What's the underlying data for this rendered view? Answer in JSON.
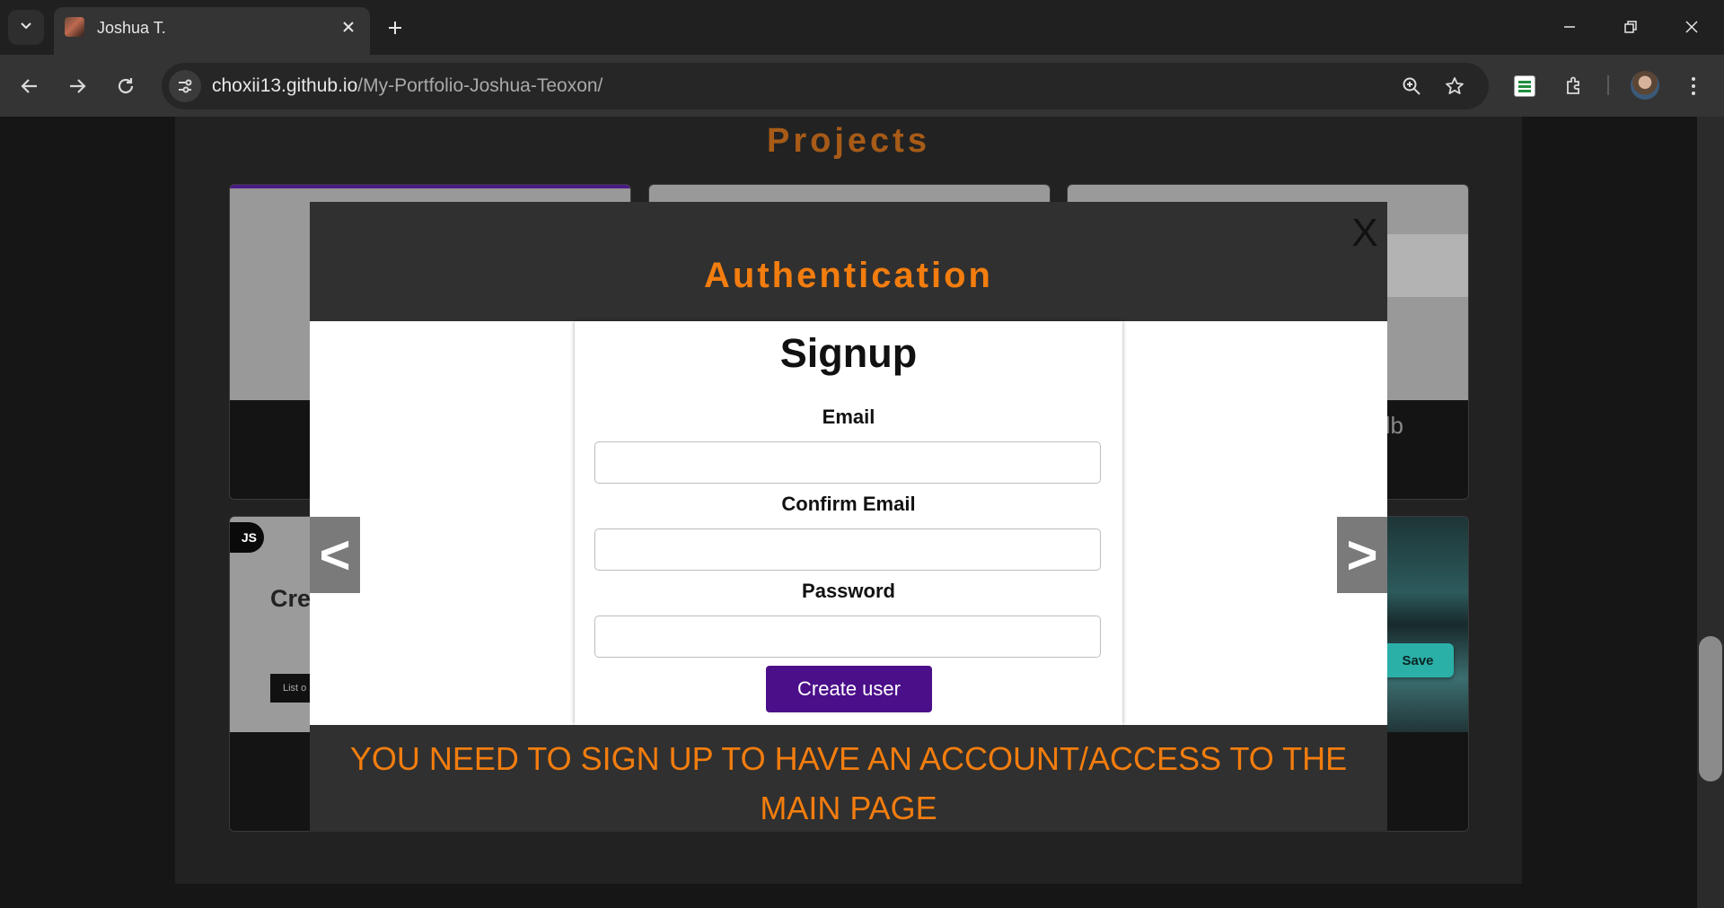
{
  "browser": {
    "tab": {
      "title": "Joshua T."
    },
    "url": {
      "host": "choxii13.github.io",
      "path": "/My-Portfolio-Joshua-Teoxon/"
    }
  },
  "page": {
    "section_title": "Projects",
    "cards": {
      "card4_badge": "JS",
      "card4_heading": "Crea",
      "card4_list": "List o",
      "card3_text": "db",
      "card6_save": "Save"
    }
  },
  "modal": {
    "close_label": "X",
    "title": "Authentication",
    "signup": {
      "title": "Signup",
      "email_label": "Email",
      "email_value": "",
      "confirm_email_label": "Confirm Email",
      "confirm_email_value": "",
      "password_label": "Password",
      "password_value": "",
      "submit_label": "Create user"
    },
    "prev_label": "<",
    "next_label": ">",
    "footer_message": "YOU NEED TO SIGN UP TO HAVE AN ACCOUNT/ACCESS TO THE MAIN PAGE"
  },
  "colors": {
    "accent_orange": "#f37d0e",
    "projects_title": "#a75b17",
    "submit_purple": "#4b0f8a"
  }
}
